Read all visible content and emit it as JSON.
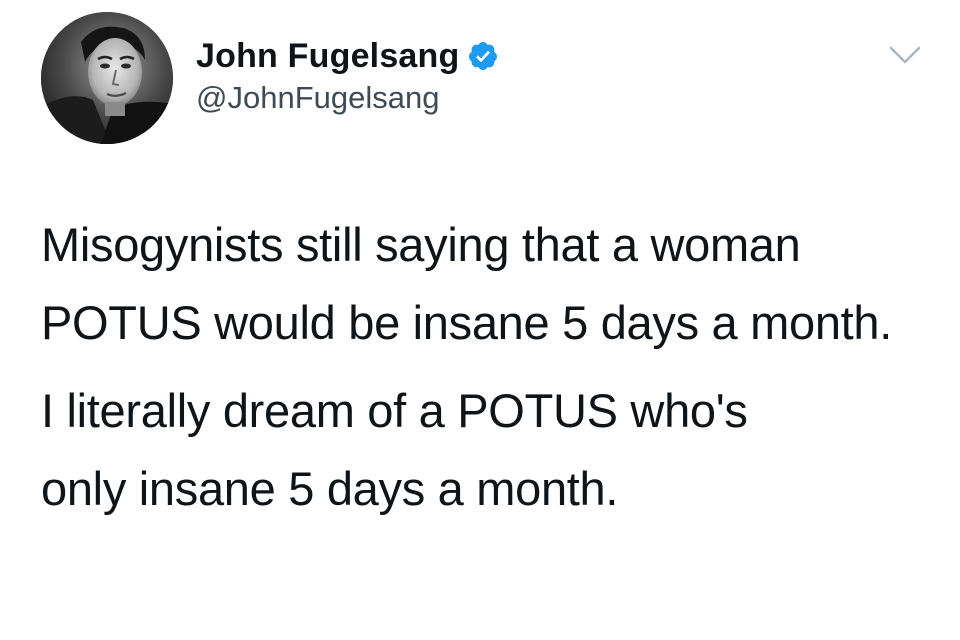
{
  "author": {
    "display_name": "John Fugelsang",
    "handle": "@JohnFugelsang",
    "verified": true,
    "avatar_icon": "profile-photo"
  },
  "menu": {
    "icon": "chevron-down-icon"
  },
  "tweet": {
    "paragraphs": [
      "Misogynists still saying that a woman POTUS would be insane 5 days a month.",
      "I literally dream of a POTUS who's only insane 5 days a month."
    ]
  },
  "colors": {
    "verified_badge": "#1d9bf0",
    "text_primary": "#0f1419",
    "text_secondary": "#3f4a55",
    "chevron": "#aab8c2",
    "background": "#ffffff"
  }
}
